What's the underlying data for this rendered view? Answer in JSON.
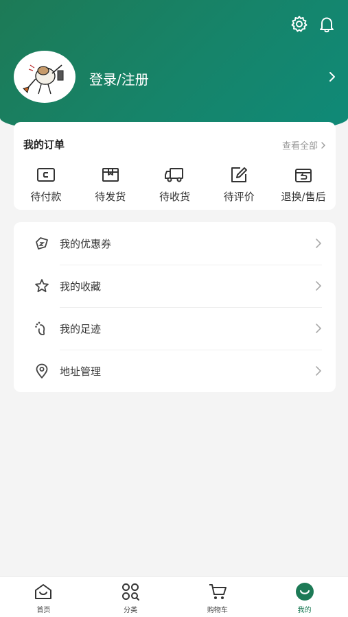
{
  "header": {
    "login_label": "登录/注册",
    "icons": [
      "settings-icon",
      "bell-icon",
      "chevron-right-icon"
    ]
  },
  "orders": {
    "title": "我的订单",
    "view_all_label": "查看全部",
    "items": [
      {
        "label": "待付款",
        "icon": "wallet-icon"
      },
      {
        "label": "待发货",
        "icon": "box-icon"
      },
      {
        "label": "待收货",
        "icon": "truck-icon"
      },
      {
        "label": "待评价",
        "icon": "edit-icon"
      },
      {
        "label": "退换/售后",
        "icon": "return-icon"
      }
    ]
  },
  "menu": {
    "items": [
      {
        "label": "我的优惠券",
        "icon": "coupon-icon"
      },
      {
        "label": "我的收藏",
        "icon": "star-icon"
      },
      {
        "label": "我的足迹",
        "icon": "footprint-icon"
      },
      {
        "label": "地址管理",
        "icon": "location-icon"
      }
    ]
  },
  "tabbar": {
    "items": [
      {
        "label": "首页",
        "icon": "home-icon"
      },
      {
        "label": "分类",
        "icon": "category-icon"
      },
      {
        "label": "购物车",
        "icon": "cart-icon"
      },
      {
        "label": "我的",
        "icon": "profile-icon"
      }
    ],
    "active_index": 3
  },
  "colors": {
    "brand": "#1d7a56",
    "header_gradient_end": "#0f8a78",
    "background": "#f4f4f4"
  }
}
